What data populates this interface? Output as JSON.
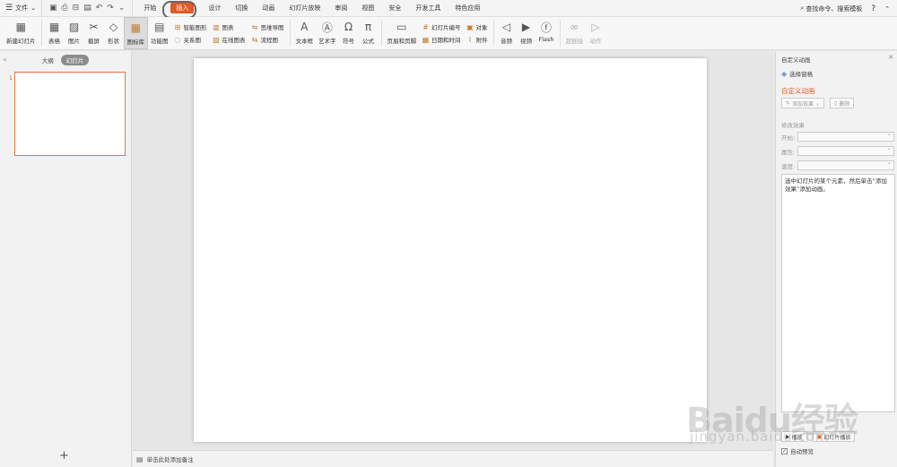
{
  "menubar": {
    "file_label": "文件",
    "tabs": [
      {
        "label": "开始"
      },
      {
        "label": "插入"
      },
      {
        "label": "设计"
      },
      {
        "label": "切换"
      },
      {
        "label": "动画"
      },
      {
        "label": "幻灯片放映"
      },
      {
        "label": "审阅"
      },
      {
        "label": "视图"
      },
      {
        "label": "安全"
      },
      {
        "label": "开发工具"
      },
      {
        "label": "特色应用"
      }
    ],
    "active_tab_index": 1,
    "search_label": "查找命令、搜索模板",
    "help_label": "?"
  },
  "ribbon": {
    "new_slide": "新建幻灯片",
    "table": "表格",
    "picture": "图片",
    "screenshot": "截屏",
    "shape": "形状",
    "icon_library": "图标库",
    "function_chart": "功能图",
    "smart_graphic": "智能图形",
    "chart": "图表",
    "mind_map": "思维导图",
    "relation_chart": "关系图",
    "online_chart": "在线图表",
    "flowchart": "流程图",
    "textbox": "文本框",
    "wordart": "艺术字",
    "symbol": "符号",
    "formula": "公式",
    "header_footer": "页眉和页脚",
    "slide_number": "幻灯片编号",
    "object": "对象",
    "date_time": "日期和时间",
    "attachment": "附件",
    "audio": "音频",
    "video": "视频",
    "flash": "Flash",
    "hyperlink": "超链接",
    "action": "动作"
  },
  "left_panel": {
    "outline_tab": "大纲",
    "slides_tab": "幻灯片",
    "slide_number": "1",
    "add_slide": "+"
  },
  "notes": {
    "placeholder": "单击此处添加备注"
  },
  "right_pane": {
    "title": "自定义动画",
    "select_pane": "选择窗格",
    "heading": "自定义动画",
    "add_effect": "添加效果",
    "delete": "删除",
    "modify_effect": "修改效果",
    "start_label": "开始:",
    "property_label": "属性:",
    "speed_label": "速度:",
    "hint": "选中幻灯片的某个元素，然后单击“添加效果”添加动画。",
    "play": "播放",
    "slideshow": "幻灯片播放",
    "auto_preview": "自动预览"
  },
  "watermark": {
    "text": "Baidu经验",
    "sub": "jingyan.baidu.com"
  }
}
